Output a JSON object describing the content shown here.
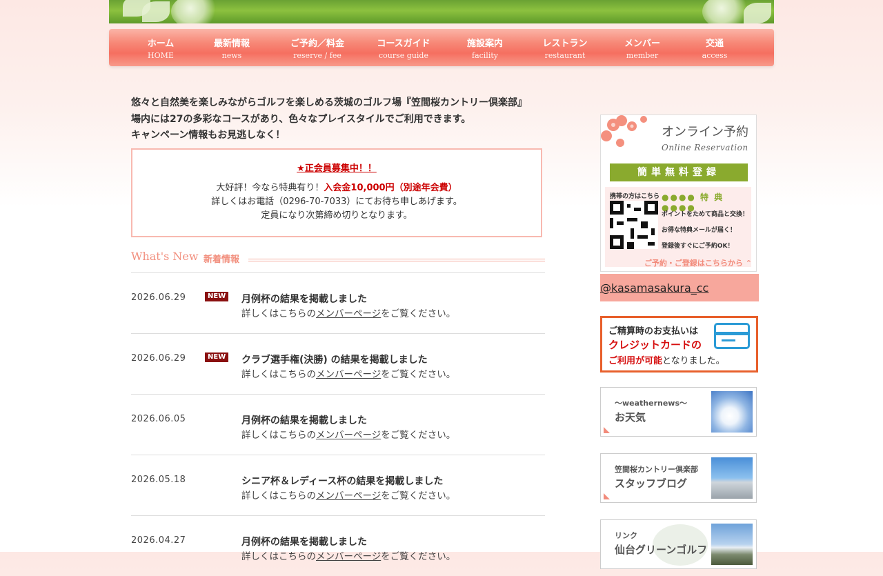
{
  "nav": {
    "items": [
      {
        "ja": "ホーム",
        "en": "HOME"
      },
      {
        "ja": "最新情報",
        "en": "news"
      },
      {
        "ja": "ご予約／料金",
        "en": "reserve / fee"
      },
      {
        "ja": "コースガイド",
        "en": "course guide"
      },
      {
        "ja": "施設案内",
        "en": "facility"
      },
      {
        "ja": "レストラン",
        "en": "restaurant"
      },
      {
        "ja": "メンバー",
        "en": "member"
      },
      {
        "ja": "交通",
        "en": "access"
      }
    ]
  },
  "intro": {
    "line1": "悠々と自然美を楽しみながらゴルフを楽しめる茨城のゴルフ場『笠間桜カントリー倶楽部』",
    "line2": "場内には27の多彩なコースがあり、色々なプレイスタイルでご利用できます。",
    "line3": "キャンペーン情報もお見逃しなく！"
  },
  "notice": {
    "title": "★正会員募集中！！",
    "line1_pre": "大好評！今なら特典有り！",
    "line1_red": "入会金10,000円（別途年会費）",
    "line2": "詳しくはお電話（0296-70-7033）にてお待ち申しあげます。",
    "line3": "定員になり次第締め切りとなります。"
  },
  "whats_new": {
    "heading_en": "What's New",
    "heading_ja": "新着情報",
    "items": [
      {
        "date": "2026.06.29",
        "badge": "NEW",
        "title": "月例杯の結果を掲載しました",
        "sub_pre": "詳しくはこちらの",
        "sub_link": "メンバーページ",
        "sub_post": "をご覧ください。"
      },
      {
        "date": "2026.06.29",
        "badge": "NEW",
        "title": "クラブ選手権(決勝) の結果を掲載しました",
        "sub_pre": "詳しくはこちらの",
        "sub_link": "メンバーページ",
        "sub_post": "をご覧ください。"
      },
      {
        "date": "2026.06.05",
        "badge": "",
        "title": "月例杯の結果を掲載しました",
        "sub_pre": "詳しくはこちらの",
        "sub_link": "メンバーページ",
        "sub_post": "をご覧ください。"
      },
      {
        "date": "2026.05.18",
        "badge": "",
        "title": "シニア杯＆レディース杯の結果を掲載しました",
        "sub_pre": "詳しくはこちらの",
        "sub_link": "メンバーページ",
        "sub_post": "をご覧ください。"
      },
      {
        "date": "2026.04.27",
        "badge": "",
        "title": "月例杯の結果を掲載しました",
        "sub_pre": "詳しくはこちらの",
        "sub_link": "メンバーページ",
        "sub_post": "をご覧ください。"
      }
    ]
  },
  "sidebar": {
    "reservation": {
      "title": "オンライン予約",
      "subtitle": "Online Reservation",
      "register": "簡単無料登録",
      "qr_label": "携帯の方はこちら",
      "perk_heading": "●●●● 特 典 ●●●●",
      "perks": [
        "ポイントをためて商品と交換！",
        "お得な特典メールが届く！",
        "登録後すぐにご予約OK！"
      ],
      "bottom": "ご予約・ご登録はこちらから"
    },
    "twitter": "@kasamasakura_cc",
    "credit": {
      "line1": "ご精算時のお支払いは",
      "line2": "クレジットカードの",
      "line3_red": "ご利用が可能",
      "line3_post": "となりました。"
    },
    "weather": {
      "small": "〜weathernews〜",
      "big": "お天気"
    },
    "blog": {
      "small": "笠間桜カントリー倶楽部",
      "big": "スタッフブログ"
    },
    "link": {
      "small": "リンク",
      "big": "仙台グリーンゴルフ"
    }
  },
  "colors": {
    "accent": "#f56f60",
    "new_badge": "#8a1010",
    "green": "#8aaa2e",
    "credit_border": "#e8602c"
  }
}
